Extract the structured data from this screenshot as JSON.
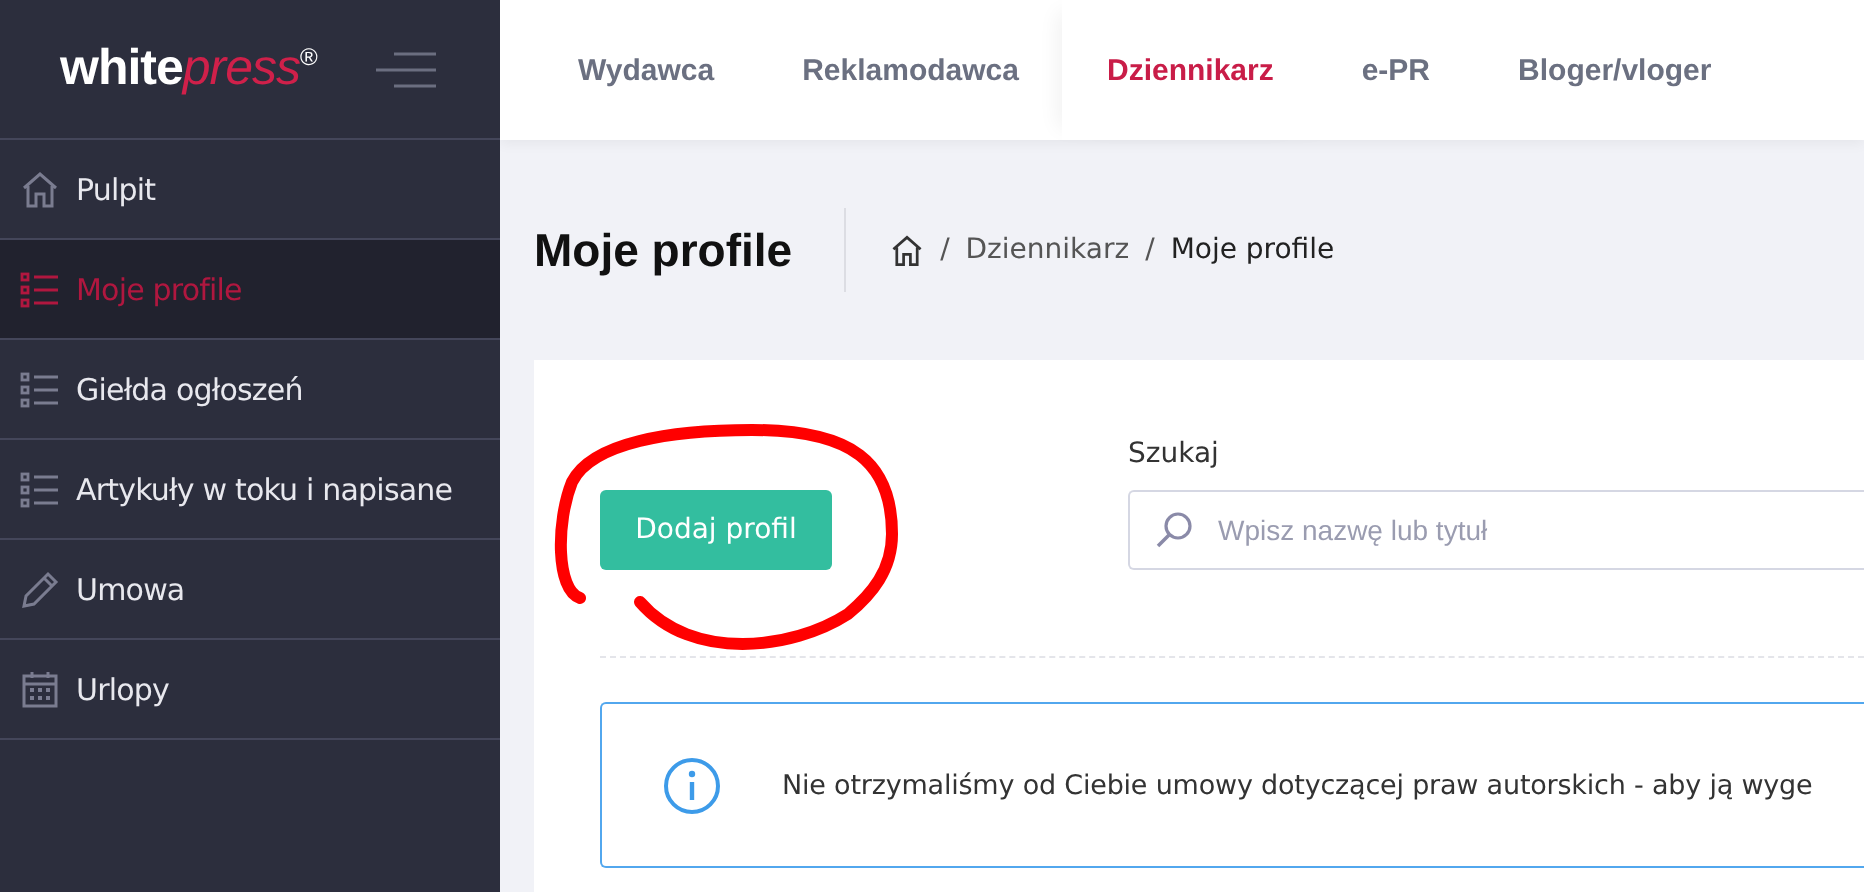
{
  "logo": {
    "text": "white",
    "accent": "press",
    "mark": "®"
  },
  "sidebar": {
    "items": [
      {
        "label": "Pulpit",
        "kind": "home",
        "selected": false
      },
      {
        "label": "Moje profile",
        "kind": "list",
        "selected": true
      },
      {
        "label": "Giełda ogłoszeń",
        "kind": "list",
        "selected": false
      },
      {
        "label": "Artykuły w toku i napisane",
        "kind": "list",
        "selected": false
      },
      {
        "label": "Umowa",
        "kind": "pencil",
        "selected": false
      },
      {
        "label": "Urlopy",
        "kind": "calendar",
        "selected": false
      }
    ]
  },
  "tabs": [
    {
      "label": "Wydawca",
      "selected": false
    },
    {
      "label": "Reklamodawca",
      "selected": false
    },
    {
      "label": "Dziennikarz",
      "selected": true
    },
    {
      "label": "e-PR",
      "selected": false
    },
    {
      "label": "Bloger/vloger",
      "selected": false
    }
  ],
  "page_title": "Moje profile",
  "breadcrumb": [
    {
      "separator": "/",
      "label": "Dziennikarz"
    },
    {
      "separator": "/",
      "label": "Moje profile"
    }
  ],
  "add_button": "Dodaj profil",
  "search": {
    "label": "Szukaj",
    "placeholder": "Wpisz nazwę lub tytuł"
  },
  "info_message": "Nie otrzymaliśmy od Ciebie umowy dotyczącej praw autorskich - aby ją wyge"
}
